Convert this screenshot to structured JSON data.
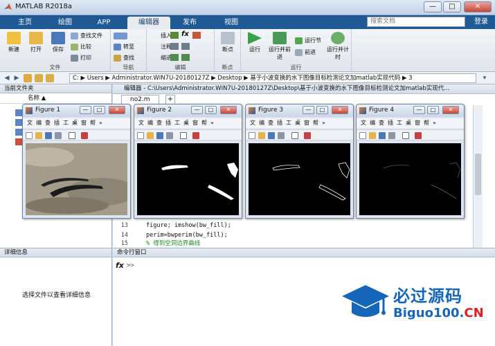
{
  "window": {
    "title": "MATLAB R2018a",
    "minimize": "—",
    "maximize": "□",
    "close": "✕"
  },
  "ribbon_tabs": [
    "主页",
    "绘图",
    "APP",
    "编辑器",
    "发布",
    "视图"
  ],
  "search": {
    "placeholder": "搜索文档"
  },
  "login_label": "登录",
  "ribbon": {
    "file": {
      "group": "文件",
      "new": "新建",
      "open": "打开",
      "save": "保存",
      "find_files": "查找文件",
      "compare": "比较",
      "print": "打印"
    },
    "navigate": {
      "group": "导航",
      "goto": "转至",
      "find": "查找"
    },
    "edit": {
      "group": "编辑",
      "insert": "插入",
      "comment": "注释",
      "indent": "缩进",
      "fx": "fx"
    },
    "breakpoints": {
      "group": "断点",
      "label": "断点"
    },
    "run": {
      "group": "运行",
      "run": "运行",
      "run_advance": "运行并前进",
      "run_section": "运行节",
      "advance": "前进",
      "run_time": "运行并计时"
    }
  },
  "address": {
    "segments": [
      "C:",
      "Users",
      "Administrator.WIN7U-20180127Z",
      "Desktop",
      "基于小波变换的水下图像目标检测论文加matlab实现代码",
      "3"
    ]
  },
  "current_folder": {
    "title": "当前文件夹",
    "col_name": "名称"
  },
  "details": {
    "title": "详细信息",
    "hint": "选择文件以查看详细信息"
  },
  "editor": {
    "header": "编辑器 - C:\\Users\\Administrator.WIN7U-20180127Z\\Desktop\\基于小波变换的水下图像目标检测论文加matlab实现代...",
    "tab": "no2.m",
    "tab_add": "+",
    "lines": [
      {
        "num": "13",
        "code": "figure; imshow(bw_fill);",
        "comment": false
      },
      {
        "num": "14",
        "code": "perim=bwperim(bw_fill);",
        "comment": false
      },
      {
        "num": "15",
        "code": "% 得到空洞边界曲线",
        "comment": true
      }
    ]
  },
  "command_window": {
    "title": "命令行窗口",
    "prompt": "fx",
    "chevrons": ">>"
  },
  "figures": [
    {
      "title": "Figure 1"
    },
    {
      "title": "Figure 2"
    },
    {
      "title": "Figure 3"
    },
    {
      "title": "Figure 4"
    }
  ],
  "figure_menu": [
    "文",
    "编",
    "查",
    "插",
    "工",
    "桌",
    "窗",
    "帮",
    "»"
  ],
  "figure_window_buttons": {
    "min": "—",
    "max": "□",
    "close": "✕"
  },
  "watermark": {
    "cn": "必过源码",
    "en_main": "Biguo100.",
    "en_tld": "CN"
  },
  "colors": {
    "ribbon_blue": "#1f5a94",
    "accent": "#1565b8",
    "code_comment": "#228b22"
  }
}
